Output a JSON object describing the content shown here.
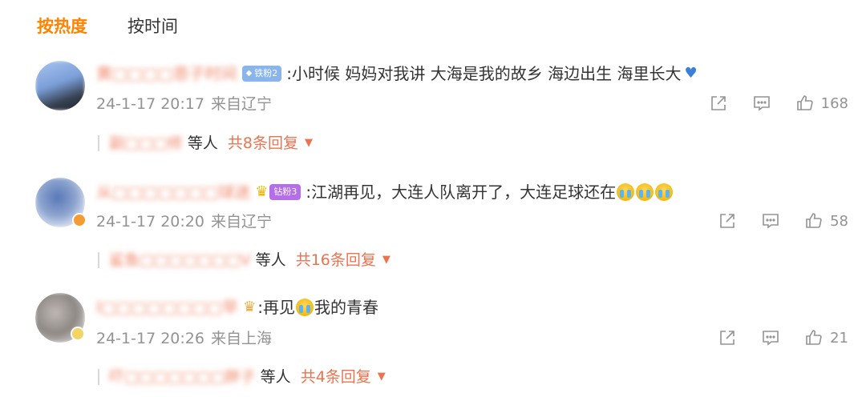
{
  "sort_tabs": {
    "hot": "按热度",
    "time": "按时间"
  },
  "comments": [
    {
      "username": "黄□□□□恩子时间",
      "badge": "铁粉2",
      "text": ":小时候 妈妈对我讲 大海是我的故乡 海边出生 海里长大",
      "time": "24-1-17 20:17",
      "source": "来自辽宁",
      "likes": "168",
      "reply_names": "副□□□修",
      "reply_etc": "等人",
      "reply_count": "共8条回复"
    },
    {
      "username": "从□□□□□□□球迷",
      "badge": "钻粉3",
      "text": ":江湖再见，大连人队离开了，大连足球还在",
      "time": "24-1-17 20:20",
      "source": "来自辽宁",
      "likes": "58",
      "reply_names": "鲨鱼□□□□□□□V",
      "reply_etc": "等人",
      "reply_count": "共16条回复"
    },
    {
      "username": "I□□□□□□□□早",
      "text_before": ":再见",
      "text_after": "我的青春",
      "time": "24-1-17 20:26",
      "source": "来自上海",
      "likes": "21",
      "reply_names": "吓□□□□□□□胖子",
      "reply_etc": "等人",
      "reply_count": "共4条回复"
    }
  ],
  "colors": {
    "accent": "#ff8200",
    "link": "#eb7350",
    "meta": "#939393"
  },
  "icons": [
    "share-icon",
    "comment-icon",
    "like-icon",
    "caret-down-icon",
    "diamond-icon",
    "crown-icon",
    "cry-emoji-icon",
    "blue-heart-icon"
  ]
}
